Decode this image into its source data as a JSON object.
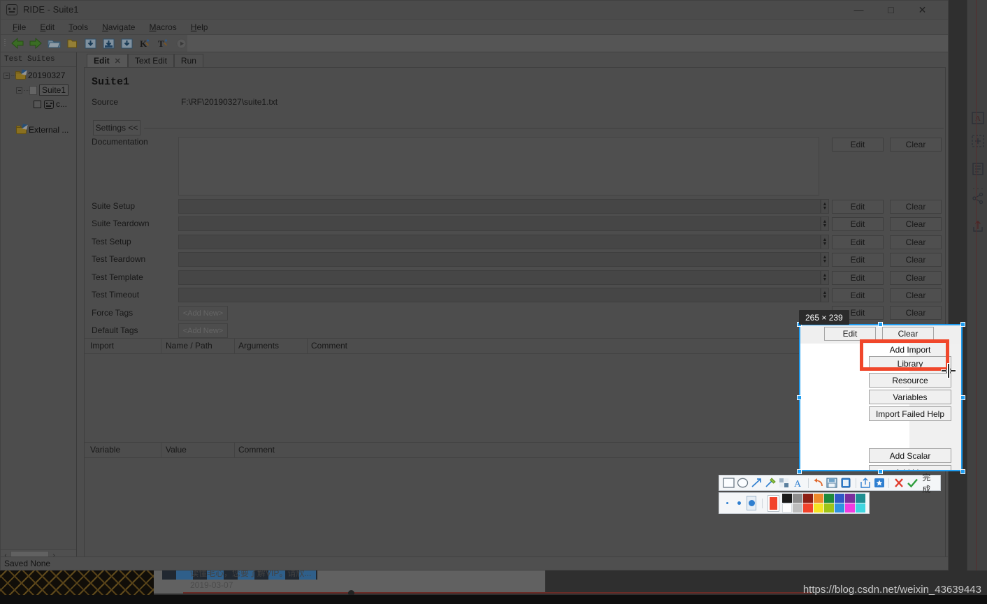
{
  "window": {
    "title": "RIDE - Suite1",
    "app_icon": "robot-icon",
    "minimize": "—",
    "maximize": "□",
    "close": "✕"
  },
  "menubar": [
    {
      "label": "File",
      "mnemonic": "F"
    },
    {
      "label": "Edit",
      "mnemonic": "E"
    },
    {
      "label": "Tools",
      "mnemonic": "T"
    },
    {
      "label": "Navigate",
      "mnemonic": "N"
    },
    {
      "label": "Macros",
      "mnemonic": "M"
    },
    {
      "label": "Help",
      "mnemonic": "H"
    }
  ],
  "toolbar": {
    "items": [
      {
        "name": "back-arrow-icon",
        "glyph": "←"
      },
      {
        "name": "forward-arrow-icon",
        "glyph": "→"
      },
      {
        "name": "open-folder-icon",
        "glyph": "open"
      },
      {
        "name": "new-folder-icon",
        "glyph": "folder"
      },
      {
        "name": "save-icon",
        "glyph": "save"
      },
      {
        "name": "save-all-icon",
        "glyph": "save-all"
      },
      {
        "name": "save-as-icon",
        "glyph": "save-as"
      },
      {
        "name": "keyword-icon",
        "glyph": "K"
      },
      {
        "name": "testcase-icon",
        "glyph": "T"
      },
      {
        "name": "run-icon",
        "glyph": "▶"
      },
      {
        "name": "debug-icon",
        "glyph": "bug"
      },
      {
        "name": "stop-icon",
        "glyph": "●"
      }
    ]
  },
  "tree": {
    "title": "Test Suites",
    "nodes": [
      {
        "label": "20190327",
        "type": "suite-folder",
        "expander": "−"
      },
      {
        "label": "Suite1",
        "type": "suite-file",
        "expander": "−",
        "selected": true
      },
      {
        "label": "c...",
        "type": "testcase",
        "checkbox": false
      },
      {
        "label": "External ...",
        "type": "external-folder"
      }
    ],
    "hscroll_left": "‹",
    "hscroll_right": "›"
  },
  "tabs": [
    {
      "label": "Edit",
      "active": true,
      "close": "✕"
    },
    {
      "label": "Text Edit",
      "active": false
    },
    {
      "label": "Run",
      "active": false
    }
  ],
  "editor": {
    "suite_name": "Suite1",
    "source_label": "Source",
    "source_value": "F:\\RF\\20190327\\suite1.txt",
    "settings_toggle": "Settings <<",
    "settings_rows": [
      {
        "label": "Documentation",
        "type": "textarea",
        "value": "",
        "edit": "Edit",
        "clear": "Clear"
      },
      {
        "label": "Suite Setup",
        "type": "field",
        "value": "",
        "edit": "Edit",
        "clear": "Clear"
      },
      {
        "label": "Suite Teardown",
        "type": "field",
        "value": "",
        "edit": "Edit",
        "clear": "Clear"
      },
      {
        "label": "Test Setup",
        "type": "field",
        "value": "",
        "edit": "Edit",
        "clear": "Clear"
      },
      {
        "label": "Test Teardown",
        "type": "field",
        "value": "",
        "edit": "Edit",
        "clear": "Clear"
      },
      {
        "label": "Test Template",
        "type": "field",
        "value": "",
        "edit": "Edit",
        "clear": "Clear"
      },
      {
        "label": "Test Timeout",
        "type": "field",
        "value": "",
        "edit": "Edit",
        "clear": "Clear"
      },
      {
        "label": "Force Tags",
        "type": "tags",
        "value": "<Add New>",
        "edit": "Edit",
        "clear": "Clear"
      },
      {
        "label": "Default Tags",
        "type": "tags",
        "value": "<Add New>",
        "edit": "Edit",
        "clear": "Clear"
      }
    ],
    "import_table": {
      "columns": [
        "Import",
        "Name / Path",
        "Arguments",
        "Comment"
      ],
      "rows": []
    },
    "variable_table": {
      "columns": [
        "Variable",
        "Value",
        "Comment"
      ],
      "rows": []
    }
  },
  "statusbar": {
    "text": "Saved None"
  },
  "selection": {
    "size_badge": "265 × 239",
    "top_buttons": [
      {
        "label": "Edit"
      },
      {
        "label": "Clear"
      }
    ],
    "section_label": "Add Import",
    "buttons": [
      {
        "label": "Library",
        "highlighted": true
      },
      {
        "label": "Resource",
        "highlighted": false
      },
      {
        "label": "Variables",
        "highlighted": false
      },
      {
        "label": "Import Failed Help",
        "highlighted": false
      },
      {
        "label": "Add Scalar",
        "highlighted": false
      },
      {
        "label": "Add List",
        "highlighted": false
      }
    ],
    "border_color": "#1f9cf0",
    "highlight_color": "#f0472b"
  },
  "screenshot_toolbar": {
    "tools": [
      {
        "name": "rectangle-tool-icon",
        "glyph": "rect"
      },
      {
        "name": "ellipse-tool-icon",
        "glyph": "ellipse"
      },
      {
        "name": "arrow-tool-icon",
        "glyph": "arrow"
      },
      {
        "name": "brush-tool-icon",
        "glyph": "brush"
      },
      {
        "name": "mosaic-tool-icon",
        "glyph": "mosaic"
      },
      {
        "name": "text-tool-icon",
        "glyph": "A"
      },
      {
        "name": "undo-icon",
        "glyph": "undo"
      },
      {
        "name": "save-icon",
        "glyph": "save"
      },
      {
        "name": "pin-icon",
        "glyph": "pin"
      },
      {
        "name": "share-icon",
        "glyph": "share"
      },
      {
        "name": "favorite-icon",
        "glyph": "star"
      },
      {
        "name": "cancel-icon",
        "glyph": "✕"
      },
      {
        "name": "confirm-icon",
        "glyph": "✓"
      }
    ],
    "done_label": "完成",
    "brush_sizes": [
      "small",
      "medium",
      "large"
    ],
    "selected_brush": "large",
    "current_color": "#f2432b",
    "palette_row1": [
      "#1b1b1b",
      "#8c8c8c",
      "#8d1f14",
      "#ee8a2c",
      "#1f8a3b",
      "#2f58c6",
      "#7a2e9c",
      "#1e8f92"
    ],
    "palette_row2": [
      "#ffffff",
      "#bdbdbd",
      "#f2432b",
      "#f5e423",
      "#9fc417",
      "#2f93e0",
      "#f23ce0",
      "#3fd6e0"
    ]
  },
  "right_sidebar": {
    "icons": [
      {
        "name": "text-annotate-icon",
        "glyph": "A"
      },
      {
        "name": "add-icon",
        "glyph": "+"
      },
      {
        "name": "list-icon",
        "glyph": "list"
      },
      {
        "name": "share-icon",
        "glyph": "share"
      },
      {
        "name": "upload-icon",
        "glyph": "upload"
      }
    ],
    "more": "···"
  },
  "background": {
    "chat_text": "读懂毛心，您要了解VIP。请欣...",
    "chat_date": "2019-03-07"
  },
  "watermark": "https://blog.csdn.net/weixin_43639443"
}
